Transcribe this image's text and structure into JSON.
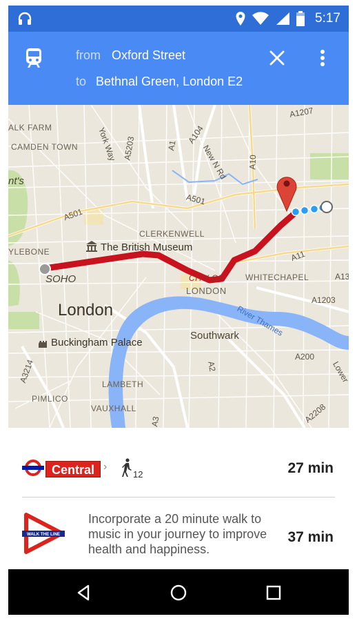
{
  "status_bar": {
    "time": "5:17",
    "icons": [
      "headphones-icon",
      "location-icon",
      "wifi-icon",
      "cell-signal-icon",
      "battery-icon"
    ]
  },
  "header": {
    "from_label": "from",
    "from_value": "Oxford Street",
    "to_label": "to",
    "to_value": "Bethnal Green, London E2",
    "icons": [
      "train-icon",
      "close-icon",
      "more-vert-icon"
    ]
  },
  "map": {
    "labels": {
      "alk_farm": "ALK FARM",
      "camden_town": "CAMDEN TOWN",
      "nts": "nt's",
      "ylebone": "YLEBONE",
      "soho": "SOHO",
      "london": "London",
      "buckingham_palace": "Buckingham Palace",
      "a3214": "A3214",
      "pimlico": "PIMLICO",
      "lambeth": "LAMBETH",
      "vauxhall": "VAUXHALL",
      "british_museum": "The British Museum",
      "clerkenwell": "CLERKENWELL",
      "a501_left": "A501",
      "a501_right": "A501",
      "york_way": "York Way",
      "a5203": "A5203",
      "a1": "A1",
      "a104": "A104",
      "new_n_rd": "New N Rd",
      "a10": "A10",
      "a1207": "A1207",
      "city_of": "CITY OF",
      "london_city": "LONDON",
      "whitechapel": "WHITECHAPEL",
      "a11": "A11",
      "a13": "A13",
      "a1203": "A1203",
      "river_thames": "River Thames",
      "southwark": "Southwark",
      "a2": "A2",
      "a200": "A200",
      "lower": "Lower",
      "a3": "A3",
      "a2208": "A2208"
    },
    "colors": {
      "route": "#c8121e",
      "water": "#8ab4f8",
      "park": "#c8dfa8",
      "land": "#ece7dc",
      "pin": "#db4437",
      "walk_dot": "#2a9df4"
    }
  },
  "options": [
    {
      "roundel_icon": "london-underground-roundel-icon",
      "line": "Central",
      "chevron": "›",
      "walk_icon": "walking-person-icon",
      "walk_minutes": "12",
      "duration": "27 min",
      "line_color": "#dc241f"
    },
    {
      "logo": "walk-the-line-logo",
      "logo_text": "WALK THE LINE",
      "text": "Incorporate a 20 minute walk to music in your journey to improve health and happiness.",
      "duration": "37 min"
    }
  ],
  "nav_bar": {
    "icons": [
      "back-icon",
      "home-icon",
      "recent-apps-icon"
    ]
  }
}
